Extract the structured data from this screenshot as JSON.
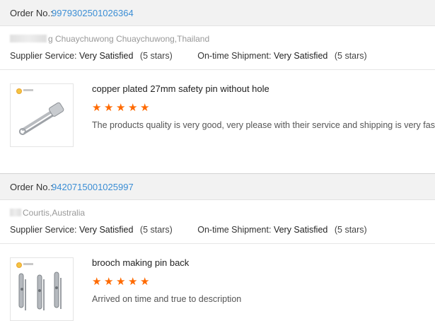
{
  "orders": [
    {
      "order_label": "Order No.:",
      "order_number": "9979302501026364",
      "buyer_location": "g Chuaychuwong Chuaychuwong,Thailand",
      "supplier_service_label": "Supplier Service:",
      "supplier_service_value": "Very Satisfied",
      "supplier_service_stars": "(5 stars)",
      "shipment_label": "On-time Shipment:",
      "shipment_value": "Very Satisfied",
      "shipment_stars": "(5 stars)",
      "product_name": "copper plated 27mm safety pin without hole",
      "rating": 5,
      "review": "The products quality is very good, very please with their service and shipping is very fast!"
    },
    {
      "order_label": "Order No.:",
      "order_number": "9420715001025997",
      "buyer_location": "Courtis,Australia",
      "supplier_service_label": "Supplier Service:",
      "supplier_service_value": "Very Satisfied",
      "supplier_service_stars": "(5 stars)",
      "shipment_label": "On-time Shipment:",
      "shipment_value": "Very Satisfied",
      "shipment_stars": "(5 stars)",
      "product_name": "brooch making pin back",
      "rating": 5,
      "review": "Arrived on time and true to description"
    }
  ],
  "colors": {
    "link": "#3b8ed5",
    "star": "#ff6a00",
    "header_bg": "#f2f2f2"
  },
  "icons": {
    "rating": "star-icon"
  }
}
